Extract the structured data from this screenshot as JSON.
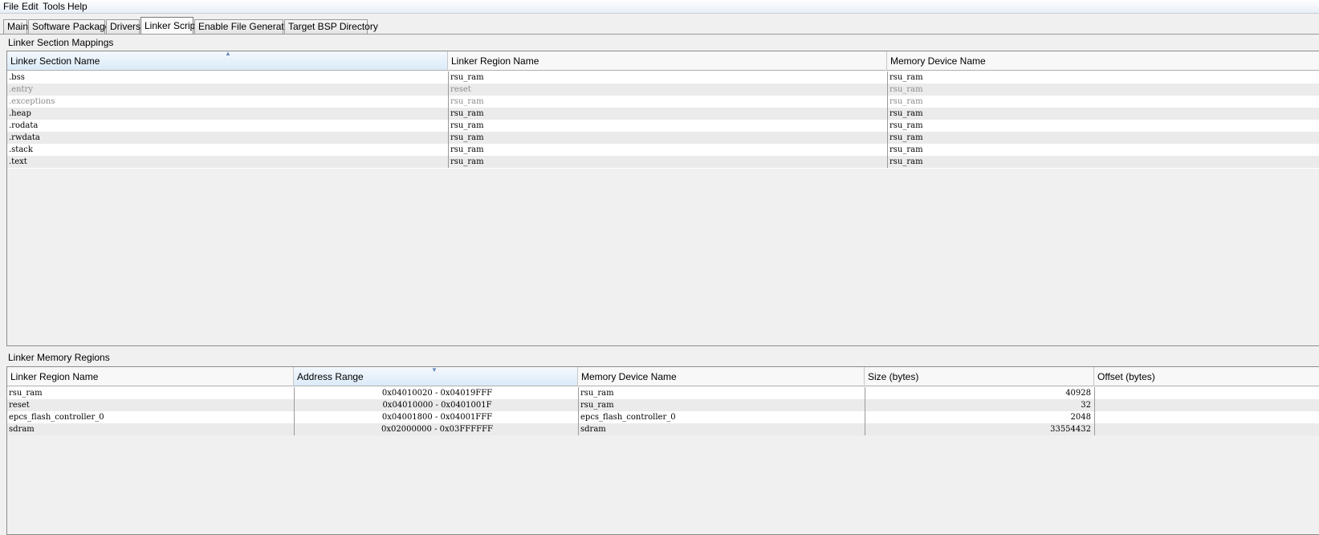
{
  "menubar": {
    "file": "File",
    "edit": "Edit",
    "tools": "Tools",
    "help": "Help"
  },
  "tabs": [
    {
      "label": "Main"
    },
    {
      "label": "Software Packages"
    },
    {
      "label": "Drivers"
    },
    {
      "label": "Linker Script",
      "active": true
    },
    {
      "label": "Enable File Generation"
    },
    {
      "label": "Target BSP Directory"
    }
  ],
  "section_mappings": {
    "title": "Linker Section Mappings",
    "columns": [
      "Linker Section Name",
      "Linker Region Name",
      "Memory Device Name"
    ],
    "sorted_column": "Linker Section Name",
    "rows": [
      {
        "section": ".bss",
        "region": "rsu_ram",
        "device": "rsu_ram",
        "disabled": false
      },
      {
        "section": ".entry",
        "region": "reset",
        "device": "rsu_ram",
        "disabled": true
      },
      {
        "section": ".exceptions",
        "region": "rsu_ram",
        "device": "rsu_ram",
        "disabled": true
      },
      {
        "section": ".heap",
        "region": "rsu_ram",
        "device": "rsu_ram",
        "disabled": false
      },
      {
        "section": ".rodata",
        "region": "rsu_ram",
        "device": "rsu_ram",
        "disabled": false
      },
      {
        "section": ".rwdata",
        "region": "rsu_ram",
        "device": "rsu_ram",
        "disabled": false
      },
      {
        "section": ".stack",
        "region": "rsu_ram",
        "device": "rsu_ram",
        "disabled": false
      },
      {
        "section": ".text",
        "region": "rsu_ram",
        "device": "rsu_ram",
        "disabled": false
      }
    ]
  },
  "memory_regions": {
    "title": "Linker Memory Regions",
    "columns": [
      "Linker Region Name",
      "Address Range",
      "Memory Device Name",
      "Size (bytes)",
      "Offset (bytes)"
    ],
    "sorted_column": "Address Range",
    "rows": [
      {
        "region": "rsu_ram",
        "range": "0x04010020 - 0x04019FFF",
        "device": "rsu_ram",
        "size": "40928",
        "offset": ""
      },
      {
        "region": "reset",
        "range": "0x04010000 - 0x0401001F",
        "device": "rsu_ram",
        "size": "32",
        "offset": ""
      },
      {
        "region": "epcs_flash_controller_0",
        "range": "0x04001800 - 0x04001FFF",
        "device": "epcs_flash_controller_0",
        "size": "2048",
        "offset": ""
      },
      {
        "region": "sdram",
        "range": "0x02000000 - 0x03FFFFFF",
        "device": "sdram",
        "size": "33554432",
        "offset": ""
      }
    ]
  },
  "colors": {
    "sorted_header": "#dbeaf8",
    "alt_row": "#ebebeb",
    "disabled_text": "#8a8a8a"
  }
}
